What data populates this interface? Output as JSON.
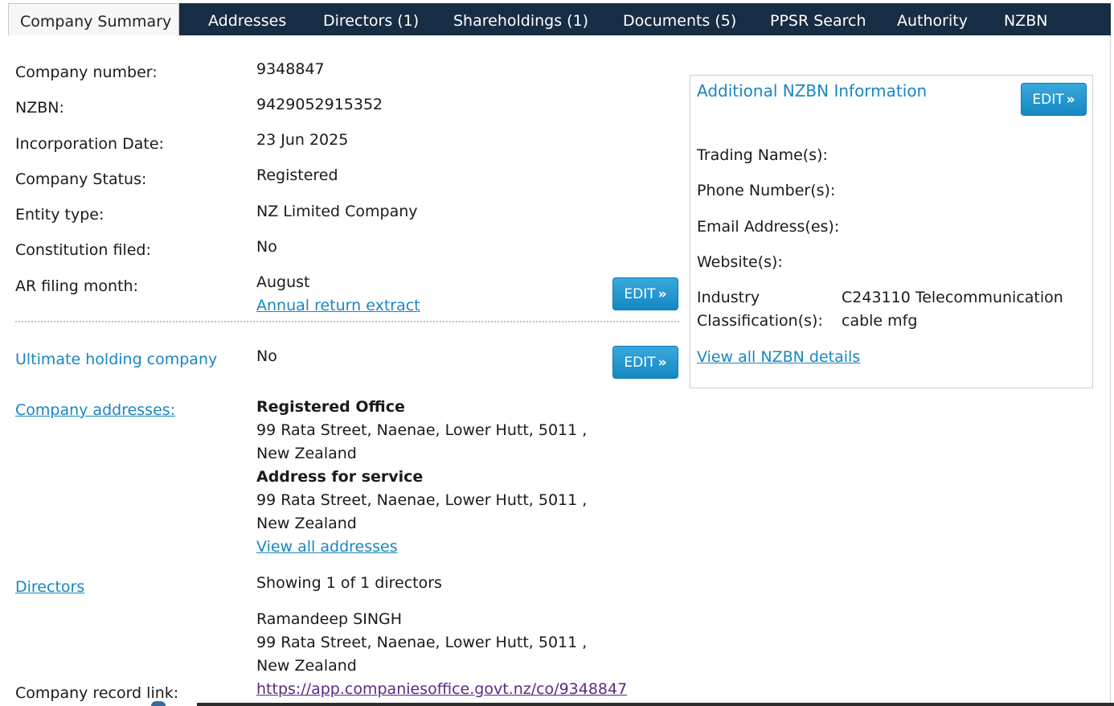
{
  "tabs": [
    {
      "label": "Company Summary",
      "active": true
    },
    {
      "label": "Addresses"
    },
    {
      "label": "Directors (1)"
    },
    {
      "label": "Shareholdings (1)"
    },
    {
      "label": "Documents (5)"
    },
    {
      "label": "PPSR Search"
    },
    {
      "label": "Authority"
    },
    {
      "label": "NZBN"
    }
  ],
  "summary": {
    "company_number_label": "Company number:",
    "company_number": "9348847",
    "nzbn_label": "NZBN:",
    "nzbn": "9429052915352",
    "incorporation_label": "Incorporation Date:",
    "incorporation": "23 Jun 2025",
    "status_label": "Company Status:",
    "status": "Registered",
    "entity_label": "Entity type:",
    "entity": "NZ Limited Company",
    "constitution_label": "Constitution filed:",
    "constitution": "No",
    "ar_label": "AR filing month:",
    "ar_month": "August",
    "ar_link": "Annual return extract",
    "edit_label": "EDIT",
    "uhc_label": "Ultimate holding company",
    "uhc": "No"
  },
  "addresses": {
    "label": "Company addresses:",
    "registered_heading": "Registered Office",
    "registered_line1": "99 Rata Street, Naenae, Lower Hutt, 5011 ,",
    "registered_line2": "New Zealand",
    "service_heading": "Address for service",
    "service_line1": "99 Rata Street, Naenae, Lower Hutt, 5011 ,",
    "service_line2": "New Zealand",
    "view_all": "View all addresses"
  },
  "directors": {
    "label": "Directors",
    "showing": "Showing 1 of 1 directors",
    "name": "Ramandeep SINGH",
    "address_line1": "99 Rata Street, Naenae, Lower Hutt, 5011 ,",
    "address_line2": "New Zealand"
  },
  "record": {
    "label": "Company record link:",
    "url": "https://app.companiesoffice.govt.nz/co/9348847"
  },
  "nzbn_panel": {
    "title": "Additional NZBN Information",
    "edit_label": "EDIT",
    "trading_label": "Trading Name(s):",
    "phone_label": "Phone Number(s):",
    "email_label": "Email Address(es):",
    "website_label": "Website(s):",
    "industry_label_1": "Industry",
    "industry_label_2": "Classification(s):",
    "industry_value_1": "C243110 Telecommunication",
    "industry_value_2": "cable mfg",
    "view_all": "View all NZBN details"
  },
  "colors": {
    "tab_bg": "#172d44",
    "link": "#1a86c1",
    "visited_link": "#5a2c85",
    "button": "#1588c2"
  }
}
